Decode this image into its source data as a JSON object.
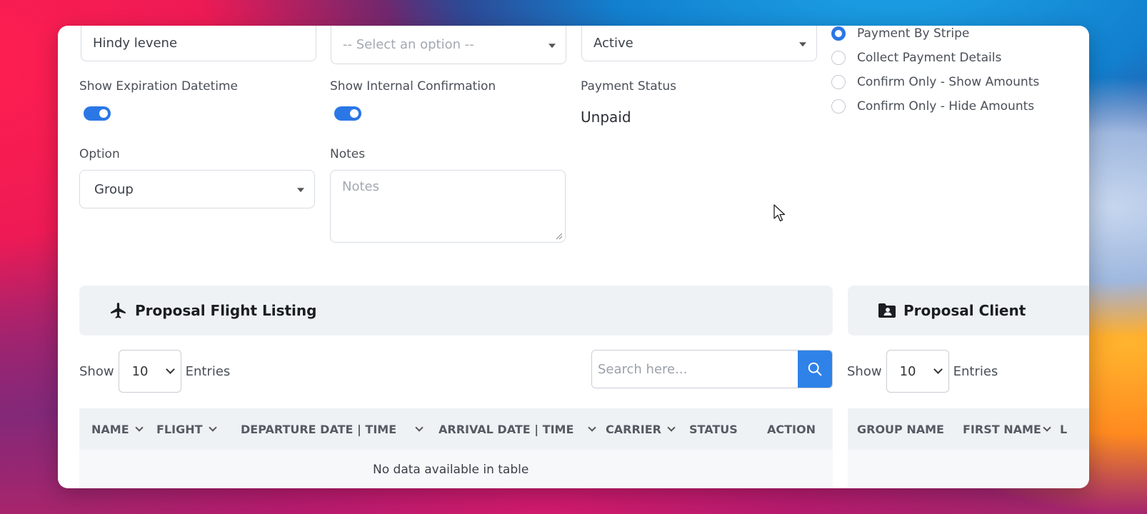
{
  "form": {
    "name_value": "Hindy levene",
    "select_placeholder": "-- Select an option --",
    "status_value": "Active",
    "show_expiration_label": "Show Expiration Datetime",
    "show_internal_label": "Show Internal Confirmation",
    "payment_status_label": "Payment Status",
    "payment_status_value": "Unpaid",
    "option_label": "Option",
    "option_value": "Group",
    "notes_label": "Notes",
    "notes_placeholder": "Notes"
  },
  "payment_options": [
    {
      "label": "Payment By Stripe",
      "checked": true
    },
    {
      "label": "Collect Payment Details",
      "checked": false
    },
    {
      "label": "Confirm Only - Show Amounts",
      "checked": false
    },
    {
      "label": "Confirm Only - Hide Amounts",
      "checked": false
    }
  ],
  "flight_section": {
    "title": "Proposal Flight Listing",
    "show_label": "Show",
    "entries_value": "10",
    "entries_label": "Entries",
    "search_placeholder": "Search here...",
    "columns": [
      "NAME",
      "FLIGHT",
      "DEPARTURE DATE | TIME",
      "ARRIVAL DATE | TIME",
      "CARRIER",
      "STATUS",
      "ACTION"
    ],
    "empty_message": "No data available in table"
  },
  "client_section": {
    "title": "Proposal Client",
    "show_label": "Show",
    "entries_value": "10",
    "entries_label": "Entries",
    "columns": [
      "GROUP NAME",
      "FIRST NAME",
      "L"
    ]
  },
  "colors": {
    "accent": "#2b77e6",
    "header_bg": "#eff2f5"
  },
  "icons": {
    "flight": "airplane-icon",
    "client": "folder-user-icon",
    "search": "search-icon"
  }
}
